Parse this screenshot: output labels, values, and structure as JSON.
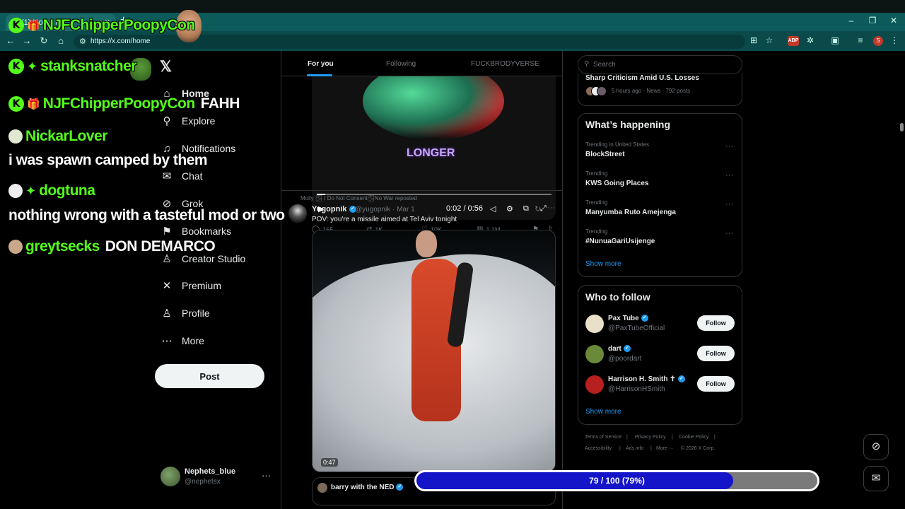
{
  "browser": {
    "tab_title": "(1) Home / X",
    "url": "https://x.com/home",
    "ext_badge": "ABP",
    "profile_initial": "S"
  },
  "nav": {
    "items": [
      {
        "label": "Home",
        "icon": "home-icon",
        "glyph": "⌂"
      },
      {
        "label": "Explore",
        "icon": "search-icon",
        "glyph": "⚲"
      },
      {
        "label": "Notifications",
        "icon": "bell-icon",
        "glyph": "♫"
      },
      {
        "label": "Chat",
        "icon": "mail-icon",
        "glyph": "✉"
      },
      {
        "label": "Grok",
        "icon": "grok-icon",
        "glyph": "⊘"
      },
      {
        "label": "Bookmarks",
        "icon": "bookmark-icon",
        "glyph": "⚑"
      },
      {
        "label": "Creator Studio",
        "icon": "creator-icon",
        "glyph": "♙"
      },
      {
        "label": "Premium",
        "icon": "x-icon",
        "glyph": "✕"
      },
      {
        "label": "Profile",
        "icon": "person-icon",
        "glyph": "♙"
      },
      {
        "label": "More",
        "icon": "more-icon",
        "glyph": "⋯"
      }
    ],
    "post_label": "Post",
    "account_name": "Nephets_blue",
    "account_handle": "@nephetsx"
  },
  "timeline": {
    "tabs": [
      "For you",
      "Following",
      "FUCKBRODYVERSE"
    ],
    "post1": {
      "video_caption": "LONGER",
      "video_time": "0:02 / 0:56",
      "replies": "165",
      "reposts": "1K",
      "likes": "10K",
      "views": "1.1M"
    },
    "post2": {
      "repost_line": "Molly 🌫 I Do Not Consent🌫No War reposted",
      "name": "Yugopnik",
      "handle": "@yugopnik · Mar 1",
      "text": "POV: you're a missile aimed at Tel Aviv tonight",
      "video_time": "0:47"
    },
    "post3": {
      "name": "barry with the NED"
    }
  },
  "sidebar": {
    "search_placeholder": "Search",
    "news": {
      "title": "Sharp Criticism Amid U.S. Losses",
      "meta": "5 hours ago · News · 792 posts"
    },
    "whats_happening": {
      "heading": "What’s happening",
      "trends": [
        {
          "context": "Trending in United States",
          "name": "BlockStreet"
        },
        {
          "context": "Trending",
          "name": "KWS Going Places"
        },
        {
          "context": "Trending",
          "name": "Manyumba Ruto Amejenga"
        },
        {
          "context": "Trending",
          "name": "#NunuaGariUsijenge"
        }
      ],
      "show_more": "Show more"
    },
    "who_to_follow": {
      "heading": "Who to follow",
      "accounts": [
        {
          "name": "Pax Tube",
          "handle": "@PaxTubeOfficial",
          "color": "#e8e0c8"
        },
        {
          "name": "dart",
          "handle": "@poordart",
          "color": "#6a8a3a"
        },
        {
          "name": "Harrison H. Smith ✝",
          "handle": "@HarrisonHSmith",
          "color": "#b82020"
        }
      ],
      "follow_label": "Follow",
      "show_more": "Show more"
    },
    "footer": {
      "links": [
        "Terms of Service",
        "|",
        "Privacy Policy",
        "|",
        "Cookie Policy",
        "|",
        "Accessibility",
        "|",
        "Ads info",
        "|",
        "More ···",
        "© 2026 X Corp."
      ]
    }
  },
  "overlay": {
    "chat": [
      {
        "user": "NJFChipperPoopyCon",
        "message": "",
        "badges": [
          "kick",
          "gift"
        ]
      },
      {
        "user": "stanksnatcher",
        "message": "",
        "badges": [
          "kick",
          "gem"
        ]
      },
      {
        "user": "NJFChipperPoopyCon",
        "message": "FAHH",
        "badges": [
          "kick",
          "gift"
        ]
      },
      {
        "user": "NickarLover",
        "message": "i was spawn camped by them",
        "badges": [
          "avatar"
        ]
      },
      {
        "user": "dogtuna",
        "message": "nothing wrong with a tasteful mod or two",
        "badges": [
          "avatar",
          "gem"
        ]
      },
      {
        "user": "greytsecks",
        "message": "DON DEMARCO",
        "badges": [
          "avatar"
        ]
      }
    ],
    "goal": {
      "current": 79,
      "target": 100,
      "fraction": 0.79,
      "label": "79 / 100 (79%)"
    }
  },
  "colors": {
    "accent": "#1d9bf0",
    "chat_user": "#53fc18",
    "goal_fill": "#1414c8"
  }
}
